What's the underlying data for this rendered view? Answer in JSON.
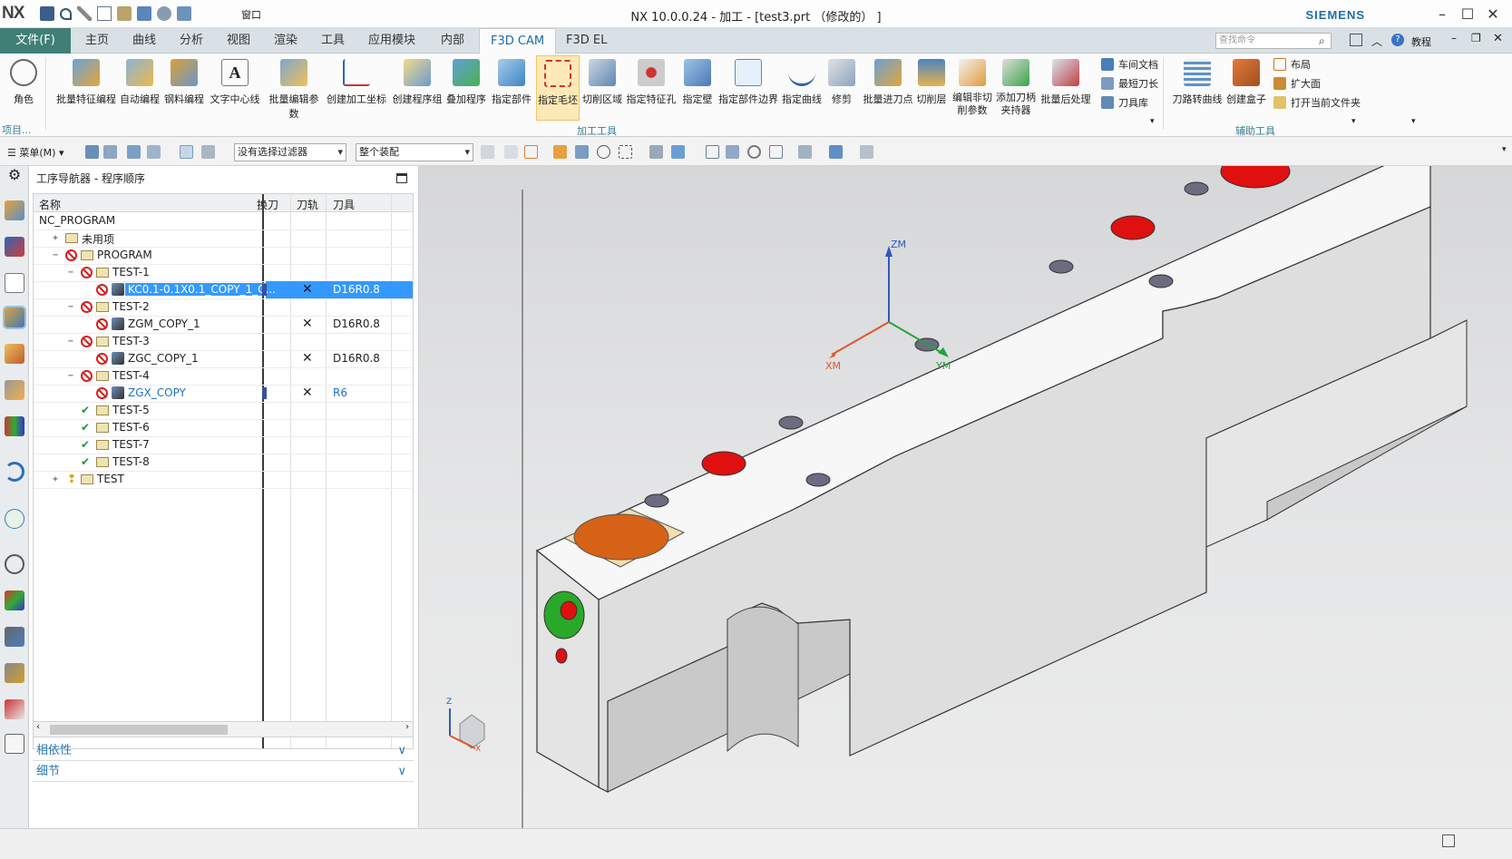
{
  "window": {
    "app_logo": "NX",
    "title": "NX 10.0.0.24 - 加工 - [test3.prt （修改的） ]",
    "brand": "SIEMENS",
    "window_menu": "窗口"
  },
  "menubar": {
    "file": "文件(F)",
    "tabs": [
      "主页",
      "曲线",
      "分析",
      "视图",
      "渲染",
      "工具",
      "应用模块",
      "内部",
      "F3D CAM",
      "F3D EL"
    ],
    "active_tab": "F3D CAM",
    "search_placeholder": "查找命令",
    "tutorial": "教程"
  },
  "ribbon": {
    "left_label": "项目...",
    "buttons": [
      "角色",
      "批量特征编程",
      "自动编程",
      "钢料编程",
      "文字中心线",
      "批量编辑参数",
      "创建加工坐标",
      "创建程序组",
      "叠加程序",
      "指定部件",
      "指定毛坯",
      "切削区域",
      "指定特征孔",
      "指定壁",
      "指定部件边界",
      "指定曲线",
      "修剪",
      "批量进刀点",
      "切削层",
      "编辑非切削参数",
      "添加刀柄夹持器",
      "批量后处理"
    ],
    "small_group1": [
      "车间文档",
      "最短刀长",
      "刀具库"
    ],
    "small_group2": [
      "布局",
      "扩大面",
      "打开当前文件夹"
    ],
    "big2": [
      "刀路转曲线",
      "创建盒子"
    ],
    "group1": "加工工具",
    "group2": "辅助工具"
  },
  "toolbar": {
    "menu": "菜单(M)",
    "filter": "没有选择过滤器",
    "assembly": "整个装配"
  },
  "navigator": {
    "title": "工序导航器 - 程序顺序",
    "columns": [
      "名称",
      "换刀",
      "刀轨",
      "刀具"
    ],
    "rows": [
      {
        "name": "NC_PROGRAM",
        "indent": 0,
        "status": "",
        "tool": "",
        "toolchange": false,
        "path": false,
        "kind": "root"
      },
      {
        "name": "未用项",
        "indent": 1,
        "status": "",
        "tool": "",
        "toolchange": false,
        "path": false,
        "kind": "group",
        "exp": "+"
      },
      {
        "name": "PROGRAM",
        "indent": 1,
        "status": "nogo",
        "tool": "",
        "toolchange": false,
        "path": false,
        "kind": "group",
        "exp": "-"
      },
      {
        "name": "TEST-1",
        "indent": 2,
        "status": "nogo",
        "tool": "",
        "toolchange": false,
        "path": false,
        "kind": "group",
        "exp": "-"
      },
      {
        "name": "KC0.1-0.1X0.1_COPY_1_C...",
        "indent": 3,
        "status": "nogo",
        "tool": "D16R0.8",
        "toolchange": true,
        "path": true,
        "kind": "op",
        "selected": true
      },
      {
        "name": "TEST-2",
        "indent": 2,
        "status": "nogo",
        "tool": "",
        "toolchange": false,
        "path": false,
        "kind": "group",
        "exp": "-"
      },
      {
        "name": "ZGM_COPY_1",
        "indent": 3,
        "status": "nogo",
        "tool": "D16R0.8",
        "toolchange": false,
        "path": true,
        "kind": "op"
      },
      {
        "name": "TEST-3",
        "indent": 2,
        "status": "nogo",
        "tool": "",
        "toolchange": false,
        "path": false,
        "kind": "group",
        "exp": "-"
      },
      {
        "name": "ZGC_COPY_1",
        "indent": 3,
        "status": "nogo",
        "tool": "D16R0.8",
        "toolchange": false,
        "path": true,
        "kind": "op"
      },
      {
        "name": "TEST-4",
        "indent": 2,
        "status": "nogo",
        "tool": "",
        "toolchange": false,
        "path": false,
        "kind": "group",
        "exp": "-"
      },
      {
        "name": "ZGX_COPY",
        "indent": 3,
        "status": "nogo",
        "tool": "R6",
        "toolchange": true,
        "path": true,
        "kind": "op",
        "blue": true
      },
      {
        "name": "TEST-5",
        "indent": 2,
        "status": "ok",
        "tool": "",
        "toolchange": false,
        "path": false,
        "kind": "group"
      },
      {
        "name": "TEST-6",
        "indent": 2,
        "status": "ok",
        "tool": "",
        "toolchange": false,
        "path": false,
        "kind": "group"
      },
      {
        "name": "TEST-7",
        "indent": 2,
        "status": "ok",
        "tool": "",
        "toolchange": false,
        "path": false,
        "kind": "group"
      },
      {
        "name": "TEST-8",
        "indent": 2,
        "status": "ok",
        "tool": "",
        "toolchange": false,
        "path": false,
        "kind": "group"
      },
      {
        "name": "TEST",
        "indent": 1,
        "status": "warn",
        "tool": "",
        "toolchange": false,
        "path": false,
        "kind": "group",
        "exp": "+"
      }
    ],
    "panels": [
      "相依性",
      "细节"
    ]
  },
  "viewport": {
    "axes": {
      "zm": "ZM",
      "xm": "XM",
      "ym": "YM"
    },
    "triad": {
      "z": "Z",
      "x": "X"
    }
  },
  "colors": {
    "accent": "#1d6fa5",
    "file_tab": "#3f7f75",
    "selection": "#3399ff",
    "hole_red": "#e01010",
    "hole_green": "#2aa82a"
  }
}
